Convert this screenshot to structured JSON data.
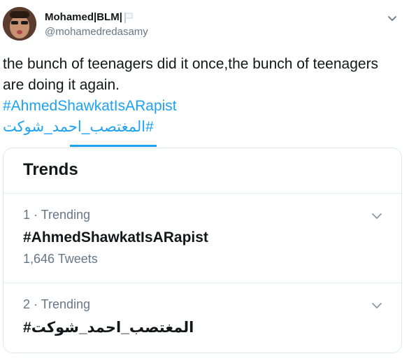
{
  "author": {
    "name": "Mohamed|BLM|",
    "handle": "@mohamedredasamy"
  },
  "tweet": {
    "text": "the bunch of teenagers did it once,the bunch of teenagers are doing it again.",
    "hashtags": [
      "#AhmedShawkatIsARapist",
      "#المغتصب_احمد_شوكت"
    ]
  },
  "trends_card": {
    "title": "Trends",
    "items": [
      {
        "meta": "1 · Trending",
        "name": "#AhmedShawkatIsARapist",
        "count": "1,646 Tweets"
      },
      {
        "meta": "2 · Trending",
        "name": "#المغتصب_احمد_شوكت"
      }
    ]
  },
  "colors": {
    "accent": "#1da1f2",
    "text": "#14171a",
    "secondary": "#657786",
    "border": "#e1e8ed"
  },
  "icons": [
    "flag-icon",
    "chevron-down-icon"
  ]
}
